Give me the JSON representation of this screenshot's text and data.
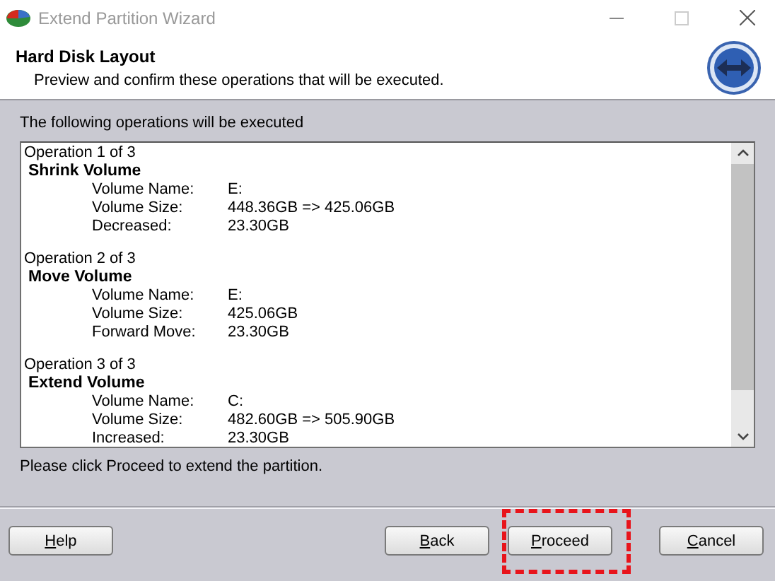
{
  "window": {
    "title": "Extend Partition Wizard"
  },
  "header": {
    "title": "Hard Disk Layout",
    "subtitle": "Preview and confirm these operations that will be executed."
  },
  "list_label": "The following operations will be executed",
  "operations": [
    {
      "heading": "Operation 1 of 3",
      "name": "Shrink Volume",
      "fields": [
        {
          "label": "Volume Name:",
          "value": "E:"
        },
        {
          "label": "Volume Size:",
          "value": "448.36GB => 425.06GB"
        },
        {
          "label": "Decreased:",
          "value": "23.30GB"
        }
      ]
    },
    {
      "heading": "Operation 2 of 3",
      "name": "Move Volume",
      "fields": [
        {
          "label": "Volume Name:",
          "value": "E:"
        },
        {
          "label": "Volume Size:",
          "value": "425.06GB"
        },
        {
          "label": "Forward Move:",
          "value": "23.30GB"
        }
      ]
    },
    {
      "heading": "Operation 3 of 3",
      "name": "Extend Volume",
      "fields": [
        {
          "label": "Volume Name:",
          "value": "C:"
        },
        {
          "label": "Volume Size:",
          "value": "482.60GB => 505.90GB"
        },
        {
          "label": "Increased:",
          "value": "23.30GB"
        }
      ]
    }
  ],
  "instruction": "Please click Proceed to extend the partition.",
  "left_buttons": [
    {
      "label": "Help",
      "mnemonic": true,
      "highlighted": false
    }
  ],
  "right_buttons": [
    {
      "label": "Back",
      "mnemonic": true,
      "highlighted": false
    },
    {
      "label": "Proceed",
      "mnemonic": true,
      "highlighted": true
    },
    {
      "label": "Cancel",
      "mnemonic": true,
      "highlighted": false
    }
  ]
}
